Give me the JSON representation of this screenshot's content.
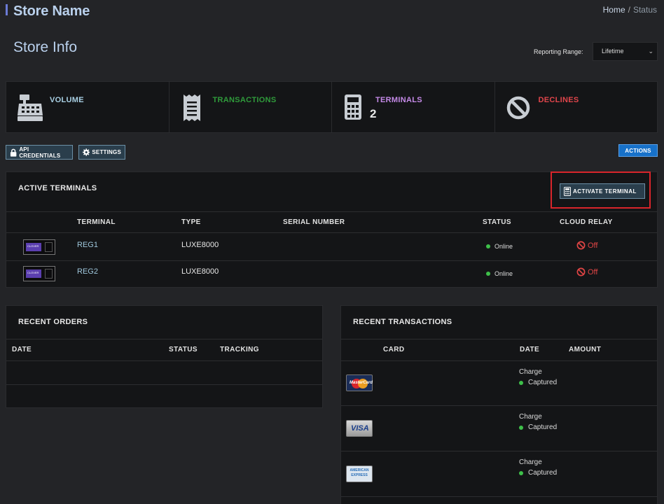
{
  "header": {
    "store_name": "Store Name",
    "breadcrumb": {
      "home": "Home",
      "separator": "/",
      "current": "Status"
    }
  },
  "page": {
    "title": "Store Info",
    "reporting_range": {
      "label": "Reporting Range:",
      "value": "Lifetime"
    }
  },
  "stats": [
    {
      "label": "VOLUME",
      "value": "",
      "color": "#a9d0e4",
      "icon": "cash-register-icon"
    },
    {
      "label": "TRANSACTIONS",
      "value": "",
      "color": "#2f9b3b",
      "icon": "receipt-icon"
    },
    {
      "label": "TERMINALS",
      "value": "2",
      "color": "#c58ae8",
      "icon": "calculator-icon"
    },
    {
      "label": "DECLINES",
      "value": "",
      "color": "#e0454b",
      "icon": "ban-icon"
    }
  ],
  "toolbar": {
    "api_credentials": "API CREDENTIALS",
    "settings": "SETTINGS",
    "actions": "ACTIONS"
  },
  "active_terminals": {
    "title": "ACTIVE TERMINALS",
    "activate_label": "ACTIVATE TERMINAL",
    "columns": [
      "TERMINAL",
      "TYPE",
      "SERIAL NUMBER",
      "STATUS",
      "CLOUD RELAY"
    ],
    "device_screen_text": "CLOVER",
    "rows": [
      {
        "terminal": "REG1",
        "type": "LUXE8000",
        "serial": "",
        "status": "Online",
        "cloud_relay": "Off"
      },
      {
        "terminal": "REG2",
        "type": "LUXE8000",
        "serial": "",
        "status": "Online",
        "cloud_relay": "Off"
      }
    ]
  },
  "recent_orders": {
    "title": "RECENT ORDERS",
    "columns": [
      "DATE",
      "STATUS",
      "TRACKING"
    ]
  },
  "recent_transactions": {
    "title": "RECENT TRANSACTIONS",
    "columns": [
      "CARD",
      "DATE",
      "AMOUNT"
    ],
    "rows": [
      {
        "card": "mastercard",
        "card_text": "MasterCard",
        "type": "Charge",
        "status": "Captured"
      },
      {
        "card": "visa",
        "card_text": "VISA",
        "type": "Charge",
        "status": "Captured"
      },
      {
        "card": "amex",
        "card_text": "AMERICAN EXPRESS",
        "type": "Charge",
        "status": "Captured"
      }
    ]
  }
}
